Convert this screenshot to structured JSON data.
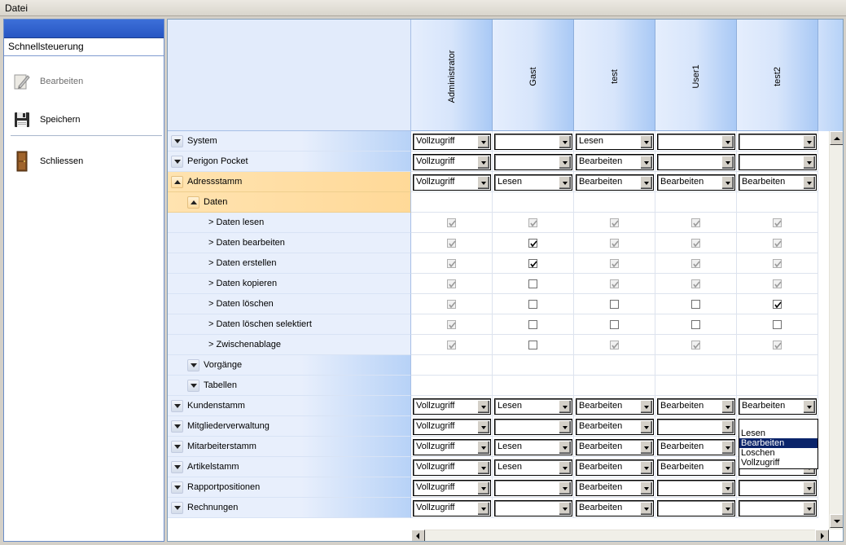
{
  "menu": {
    "file": "Datei"
  },
  "sidebar": {
    "title": "Schnellsteuerung",
    "actions": [
      {
        "label": "Bearbeiten",
        "icon": "edit-pencil-icon",
        "enabled": false
      },
      {
        "label": "Speichern",
        "icon": "floppy-disk-icon",
        "enabled": true
      },
      {
        "label": "Schliessen",
        "icon": "exit-door-icon",
        "enabled": true
      }
    ]
  },
  "grid": {
    "columns": [
      "Administrator",
      "Gast",
      "test",
      "User1",
      "test2"
    ],
    "rows": [
      {
        "label": "System",
        "level": 0,
        "expander": "down",
        "type": "combo",
        "values": [
          "Vollzugriff",
          "",
          "Lesen",
          "",
          ""
        ]
      },
      {
        "label": "Perigon Pocket",
        "level": 0,
        "expander": "down",
        "type": "combo",
        "values": [
          "Vollzugriff",
          "",
          "Bearbeiten",
          "",
          ""
        ]
      },
      {
        "label": "Adressstamm",
        "level": 0,
        "expander": "up",
        "selected": true,
        "type": "combo",
        "values": [
          "Vollzugriff",
          "Lesen",
          "Bearbeiten",
          "Bearbeiten",
          "Bearbeiten"
        ]
      },
      {
        "label": "Daten",
        "level": 1,
        "expander": "up",
        "selected": true,
        "type": "none"
      },
      {
        "label": "> Daten lesen",
        "level": 2,
        "type": "check",
        "checks": [
          [
            true,
            true
          ],
          [
            true,
            true
          ],
          [
            true,
            true
          ],
          [
            true,
            true
          ],
          [
            true,
            true
          ]
        ]
      },
      {
        "label": "> Daten bearbeiten",
        "level": 2,
        "type": "check",
        "checks": [
          [
            true,
            true
          ],
          [
            true,
            false
          ],
          [
            true,
            true
          ],
          [
            true,
            true
          ],
          [
            true,
            true
          ]
        ]
      },
      {
        "label": "> Daten erstellen",
        "level": 2,
        "type": "check",
        "checks": [
          [
            true,
            true
          ],
          [
            true,
            false
          ],
          [
            true,
            true
          ],
          [
            true,
            true
          ],
          [
            true,
            true
          ]
        ]
      },
      {
        "label": "> Daten kopieren",
        "level": 2,
        "type": "check",
        "checks": [
          [
            true,
            true
          ],
          [
            false,
            false
          ],
          [
            true,
            true
          ],
          [
            true,
            true
          ],
          [
            true,
            true
          ]
        ]
      },
      {
        "label": "> Daten löschen",
        "level": 2,
        "type": "check",
        "checks": [
          [
            true,
            true
          ],
          [
            false,
            false
          ],
          [
            false,
            false
          ],
          [
            false,
            false
          ],
          [
            true,
            false
          ]
        ]
      },
      {
        "label": "> Daten löschen selektiert",
        "level": 2,
        "type": "check",
        "checks": [
          [
            true,
            true
          ],
          [
            false,
            false
          ],
          [
            false,
            false
          ],
          [
            false,
            false
          ],
          [
            false,
            false
          ]
        ]
      },
      {
        "label": "> Zwischenablage",
        "level": 2,
        "type": "check",
        "checks": [
          [
            true,
            true
          ],
          [
            false,
            false
          ],
          [
            true,
            true
          ],
          [
            true,
            true
          ],
          [
            true,
            true
          ]
        ]
      },
      {
        "label": "Vorgänge",
        "level": 1,
        "expander": "down",
        "type": "none"
      },
      {
        "label": "Tabellen",
        "level": 1,
        "expander": "down",
        "type": "none"
      },
      {
        "label": "Kundenstamm",
        "level": 0,
        "expander": "down",
        "type": "combo",
        "values": [
          "Vollzugriff",
          "Lesen",
          "Bearbeiten",
          "Bearbeiten",
          "Bearbeiten"
        ]
      },
      {
        "label": "Mitgliederverwaltung",
        "level": 0,
        "expander": "down",
        "type": "combo",
        "values": [
          "Vollzugriff",
          "",
          "Bearbeiten",
          "",
          ""
        ]
      },
      {
        "label": "Mitarbeiterstamm",
        "level": 0,
        "expander": "down",
        "type": "combo",
        "values": [
          "Vollzugriff",
          "Lesen",
          "Bearbeiten",
          "Bearbeiten",
          ""
        ]
      },
      {
        "label": "Artikelstamm",
        "level": 0,
        "expander": "down",
        "type": "combo",
        "values": [
          "Vollzugriff",
          "Lesen",
          "Bearbeiten",
          "Bearbeiten",
          ""
        ]
      },
      {
        "label": "Rapportpositionen",
        "level": 0,
        "expander": "down",
        "type": "combo",
        "values": [
          "Vollzugriff",
          "",
          "Bearbeiten",
          "",
          ""
        ]
      },
      {
        "label": "Rechnungen",
        "level": 0,
        "expander": "down",
        "type": "combo",
        "values": [
          "Vollzugriff",
          "",
          "Bearbeiten",
          "",
          ""
        ]
      }
    ]
  },
  "dropdown": {
    "options": [
      "Lesen",
      "Bearbeiten",
      "Loschen",
      "Vollzugriff"
    ],
    "highlighted": 1
  }
}
